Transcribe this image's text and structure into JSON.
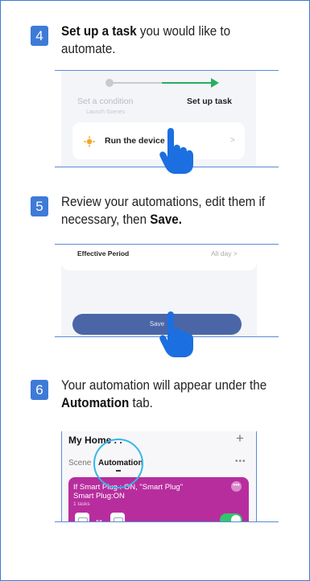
{
  "steps": [
    {
      "number": "4",
      "bold_lead": "Set up a task",
      "text": " you would like to automate.",
      "screenshot": {
        "condition_label": "Set a condition",
        "condition_sub": "Launch Scenes",
        "task_label": "Set up task",
        "device_label": "Run the device",
        "chevron": ">"
      }
    },
    {
      "number": "5",
      "text": "Review your automations, edit them if necessary, then ",
      "bold_tail": "Save.",
      "screenshot": {
        "field_label": "Effective Period",
        "field_value": "All day  >",
        "button_label": "Save"
      }
    },
    {
      "number": "6",
      "text": "Your automation will appear under the ",
      "bold_tail": "Automation",
      "text_after": " tab.",
      "screenshot": {
        "home_title": "My Home . .",
        "plus": "+",
        "tab_scene": "Scene",
        "tab_automation": "Automation",
        "more_dots": "•••",
        "card_text": "If Smart Plug : ON, \"Smart Plug\" Smart Plug:ON",
        "card_sub": "1 tasks",
        "card_more": "•••",
        "arrow": "↔",
        "toggle_on": true
      }
    }
  ],
  "colors": {
    "badge": "#3e7ad8",
    "accent_green": "#27ae60",
    "save_button": "#4a66a6",
    "automation_card": "#b72d9d",
    "highlight_circle": "#35b6e8",
    "hand_pointer": "#1b6fe0"
  }
}
